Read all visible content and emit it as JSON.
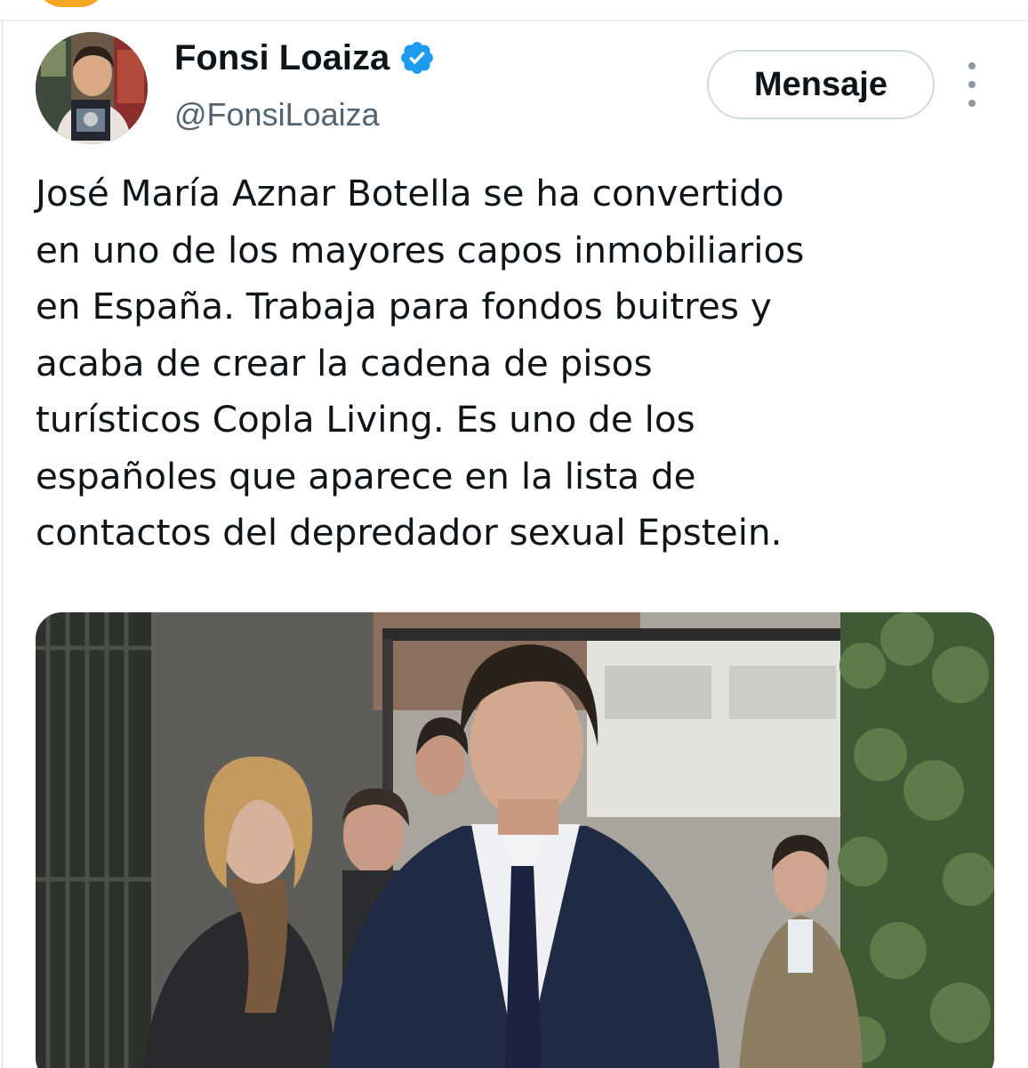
{
  "header": {
    "display_name": "Fonsi Loaiza",
    "handle": "@FonsiLoaiza",
    "message_label": "Mensaje",
    "verified_color": "#1d9bf0",
    "icons": [
      "verified-badge-icon",
      "more-options-icon"
    ]
  },
  "tweet": {
    "lines": [
      "José María Aznar Botella se ha convertido",
      "en uno de los mayores capos inmobiliarios",
      "en España. Trabaja para fondos buitres y",
      "acaba de crear la cadena de pisos",
      "turísticos Copla Living. Es uno de los",
      "españoles que aparece en la lista de",
      "contactos del depredador sexual Epstein."
    ]
  },
  "colors": {
    "text": "#0f1419",
    "secondary": "#536471",
    "border": "#cfd9de"
  }
}
